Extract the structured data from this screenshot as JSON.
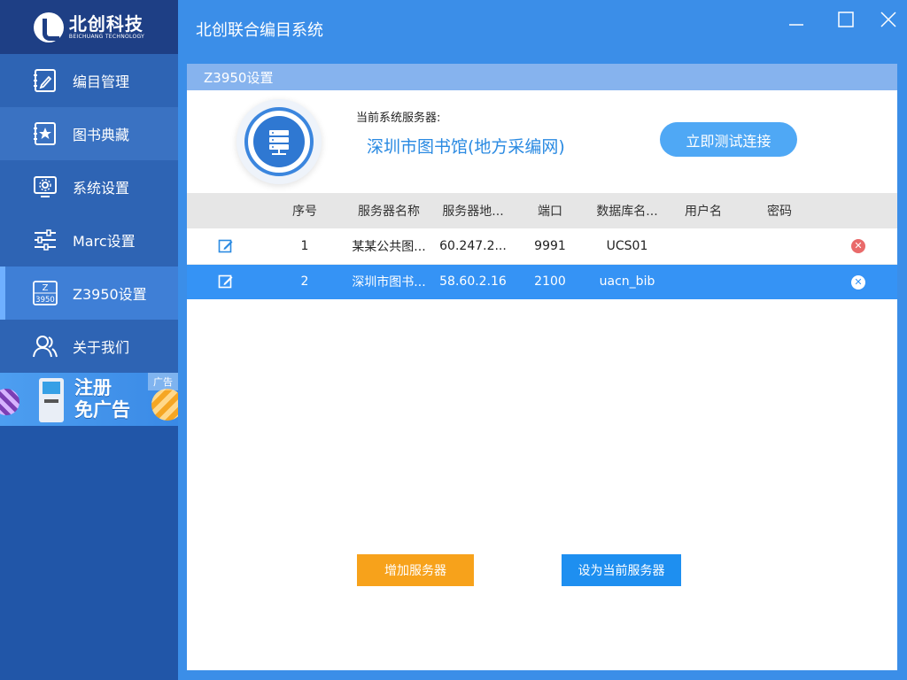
{
  "colors": {
    "sidebar": "#2156a8",
    "titlebar": "#3b8ee8",
    "selected_row": "#3593f5",
    "accent_orange": "#f7a21b",
    "accent_blue": "#1e8ff0"
  },
  "brand": {
    "name": "北创科技",
    "subtitle": "BEICHUANG TECHNOLOGY"
  },
  "window": {
    "title": "北创联合编目系统",
    "min_icon": "minimize-icon",
    "max_icon": "maximize-icon",
    "close_icon": "close-icon"
  },
  "sidebar": {
    "items": [
      {
        "label": "编目管理",
        "icon": "edit-document-icon"
      },
      {
        "label": "图书典藏",
        "icon": "star-book-icon"
      },
      {
        "label": "系统设置",
        "icon": "monitor-gear-icon"
      },
      {
        "label": "Marc设置",
        "icon": "sliders-icon"
      },
      {
        "label": "Z3950设置",
        "icon": "z3950-icon",
        "icon_text_top": "Z",
        "icon_text_bottom": "3950"
      },
      {
        "label": "关于我们",
        "icon": "users-icon"
      }
    ],
    "active_index": 4,
    "ad": {
      "line1": "注册",
      "line2": "免广告",
      "tag": "广告"
    }
  },
  "panel": {
    "title": "Z3950设置",
    "current_server_label": "当前系统服务器:",
    "current_server_value": "深圳市图书馆(地方采编网)",
    "test_button": "立即测试连接",
    "table": {
      "headers": [
        "",
        "序号",
        "服务器名称",
        "服务器地...",
        "端口",
        "数据库名...",
        "用户名",
        "密码",
        ""
      ],
      "rows": [
        {
          "index": "1",
          "name": "某某公共图...",
          "address": "60.247.2...",
          "port": "9991",
          "database": "UCS01",
          "username": "",
          "password": "",
          "selected": false
        },
        {
          "index": "2",
          "name": "深圳市图书...",
          "address": "58.60.2.16",
          "port": "2100",
          "database": "uacn_bib",
          "username": "",
          "password": "",
          "selected": true
        }
      ]
    },
    "add_button": "增加服务器",
    "set_current_button": "设为当前服务器"
  }
}
